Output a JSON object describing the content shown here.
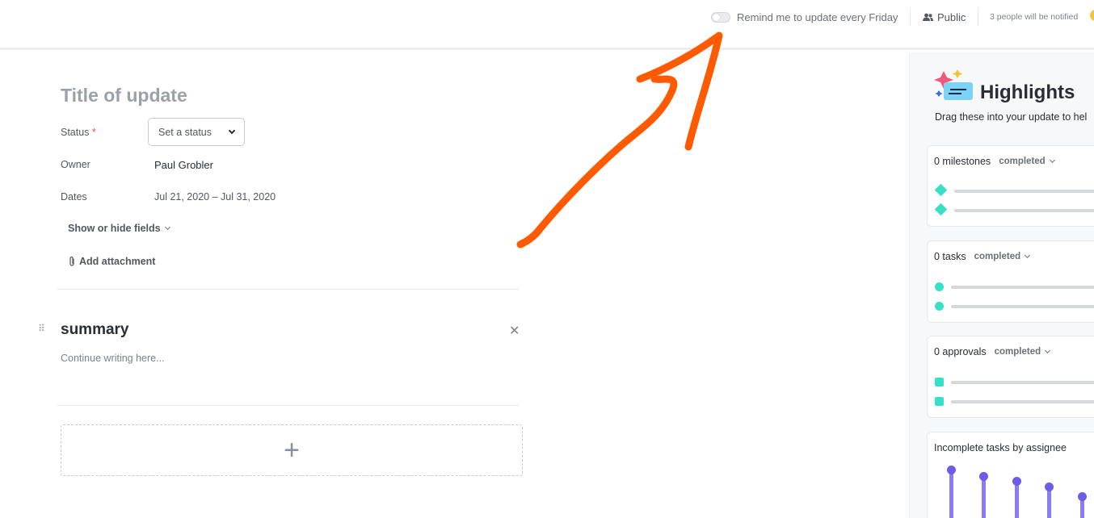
{
  "topbar": {
    "remind_label": "Remind me to update every Friday",
    "remind_enabled": false,
    "visibility_label": "Public",
    "notify_label": "3 people will be notified"
  },
  "form": {
    "title_placeholder": "Title of update",
    "status_label": "Status",
    "status_required_mark": "*",
    "status_select_placeholder": "Set a status",
    "owner_label": "Owner",
    "owner_value": "Paul Grobler",
    "dates_label": "Dates",
    "dates_value": "Jul 21, 2020 – Jul 31, 2020",
    "show_hide_label": "Show or hide fields",
    "attachment_label": "Add attachment"
  },
  "summary": {
    "title": "summary",
    "placeholder": "Continue writing here..."
  },
  "highlights": {
    "title": "Highlights",
    "subtitle": "Drag these into your update to hel",
    "cards": [
      {
        "count_label": "0 milestones",
        "filter_label": "completed"
      },
      {
        "count_label": "0 tasks",
        "filter_label": "completed"
      },
      {
        "count_label": "0 approvals",
        "filter_label": "completed"
      }
    ],
    "assignee_card_title": "Incomplete tasks by assignee"
  },
  "colors": {
    "accent_teal": "#38e0c8",
    "accent_purple": "#6c5ce7",
    "annotation_orange": "#ff5a00"
  }
}
